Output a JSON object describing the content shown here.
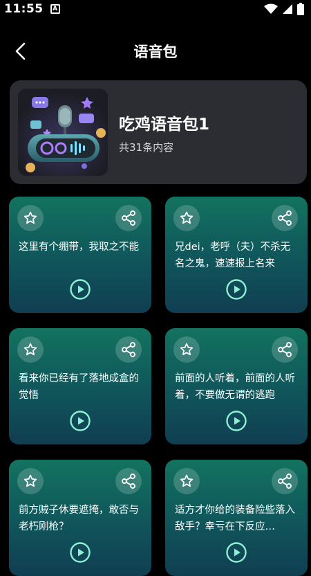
{
  "status_bar": {
    "time": "11:55",
    "app_icon": "A",
    "icons": [
      "wifi-icon",
      "signal-icon",
      "battery-icon"
    ]
  },
  "header": {
    "title": "语音包",
    "back_icon": "chevron-left-icon"
  },
  "pack": {
    "name": "吃鸡语音包1",
    "count": "共31条内容",
    "cover_icon": "microphone-speaker-icon"
  },
  "voice_items": [
    {
      "text": "这里有个绷带，我取之不能"
    },
    {
      "text": "兄dei，老呼（夫）不杀无名之鬼，速速报上名来"
    },
    {
      "text": "看来你已经有了落地成盒的觉悟"
    },
    {
      "text": "前面的人听着，前面的人听着，不要做无谓的逃跑"
    },
    {
      "text": "前方贼子休要遮掩，敢否与老朽刚枪？"
    },
    {
      "text": "适方才你给的装备险些落入敌手？幸亏在下反应…"
    }
  ],
  "icons": {
    "favorite": "star-icon",
    "share": "share-icon",
    "play": "play-icon"
  },
  "colors": {
    "background": "#000000",
    "header_card": "#2c2d33",
    "card_gradient_top": "#13735f",
    "card_gradient_bottom": "#103e52",
    "accent": "#8ff0d6"
  }
}
